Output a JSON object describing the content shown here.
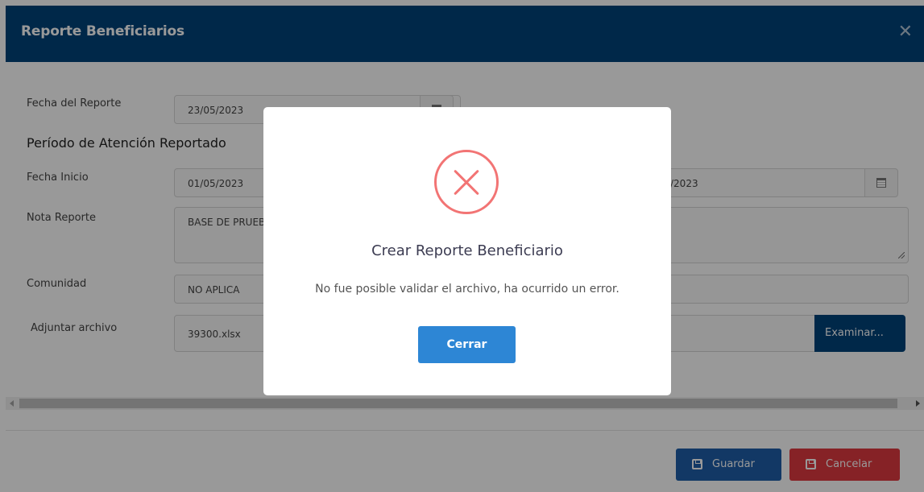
{
  "modal": {
    "title": "Reporte Beneficiarios",
    "close_glyph": "✕"
  },
  "form": {
    "fecha_reporte_label": "Fecha del Reporte",
    "fecha_reporte_value": "23/05/2023",
    "periodo_title": "Período de Atención Reportado",
    "fecha_inicio_label": "Fecha Inicio",
    "fecha_inicio_value": "01/05/2023",
    "fecha_fin_value_visible": "/2023",
    "nota_label": "Nota Reporte",
    "nota_value": "BASE DE PRUEBA",
    "comunidad_label": "Comunidad",
    "comunidad_value": "NO APLICA",
    "adjuntar_label": "Adjuntar archivo",
    "archivo_value": "39300.xlsx",
    "examinar_label": "Examinar..."
  },
  "footer": {
    "guardar_label": "Guardar",
    "cancelar_label": "Cancelar"
  },
  "alert": {
    "icon": "error-x-icon",
    "title": "Crear Reporte Beneficiario",
    "message": "No fue posible validar el archivo, ha ocurrido un error.",
    "button_label": "Cerrar"
  },
  "colors": {
    "header": "#00447b",
    "examinar": "#00447b",
    "guardar": "#1f5ea8",
    "cancelar": "#df3a40",
    "cerrar": "#2d86d5",
    "error": "#f27474"
  }
}
